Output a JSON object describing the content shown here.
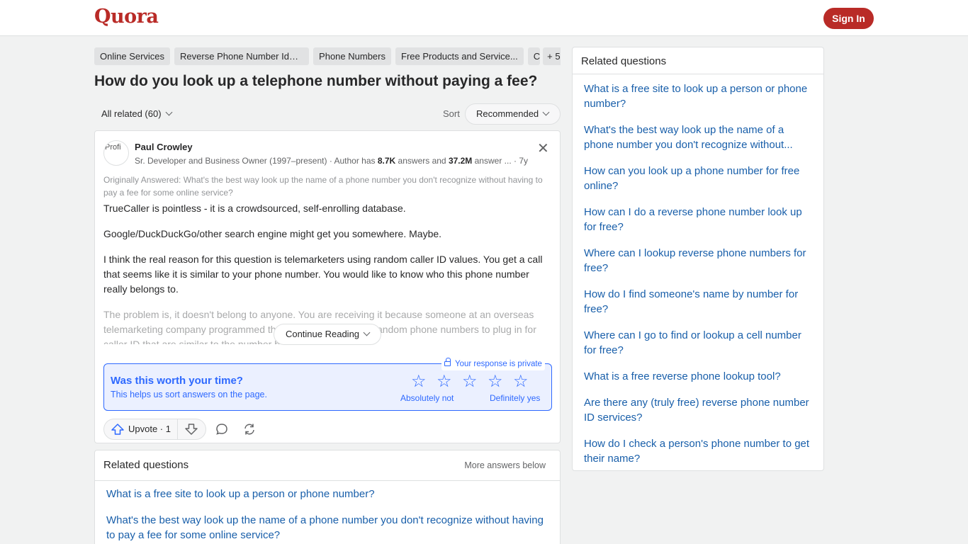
{
  "header": {
    "logo": "Quora",
    "signin_label": "Sign In"
  },
  "topics": {
    "items": [
      "Online Services",
      "Reverse Phone Number Iden...",
      "Phone Numbers",
      "Free Products and Service...",
      "C"
    ],
    "more": "+ 5"
  },
  "question": {
    "title": "How do you look up a telephone number without paying a fee?"
  },
  "filter": {
    "all_related": "All related (60)",
    "sort_label": "Sort",
    "sort_value": "Recommended"
  },
  "answer": {
    "avatar_alt": "Profi",
    "author": "Paul Crowley",
    "cred_prefix": "Sr. Developer and Business Owner (1997–present) · Author has ",
    "answers_count": "8.7K",
    "cred_mid": " answers and ",
    "views_count": "37.2M",
    "cred_suffix": " answer ...",
    "age": "· 7y",
    "originally_answered": "Originally Answered: What's the best way look up the name of a phone number you don't recognize without having to pay a fee for some online service?",
    "paragraphs": [
      "TrueCaller is pointless - it is a crowdsourced, self-enrolling database.",
      "Google/DuckDuckGo/other search engine might get you somewhere. Maybe.",
      "I think the real reason for this question is telemarketers using random caller ID values. You get a call that seems like it is similar to your phone number. You would like to know who this phone number really belongs to."
    ],
    "faded_paragraph": "The problem is, it doesn't belong to anyone. You are receiving it because someone at an overseas telemarketing company programmed their computer to select random phone numbers to plug in for caller ID that are similar to the number being c",
    "continue_reading": "Continue Reading",
    "upvote_label": "Upvote · 1"
  },
  "rating": {
    "private_note": "Your response is private",
    "title": "Was this worth your time?",
    "subtitle": "This helps us sort answers on the page.",
    "low_label": "Absolutely not",
    "high_label": "Definitely yes",
    "star_count": 5
  },
  "related_inline": {
    "title": "Related questions",
    "more": "More answers below",
    "items": [
      "What is a free site to look up a person or phone number?",
      "What's the best way look up the name of a phone number you don't recognize without having to pay a fee for some online service?"
    ]
  },
  "sidebar": {
    "title": "Related questions",
    "items": [
      "What is a free site to look up a person or phone number?",
      "What's the best way look up the name of a phone number you don't recognize without...",
      "How can you look up a phone number for free online?",
      "How can I do a reverse phone number look up for free?",
      "Where can I lookup reverse phone numbers for free?",
      "How do I find someone's name by number for free?",
      "Where can I go to find or lookup a cell number for free?",
      "What is a free reverse phone lookup tool?",
      "Are there any (truly free) reverse phone number ID services?",
      "How do I check a person's phone number to get their name?"
    ]
  }
}
